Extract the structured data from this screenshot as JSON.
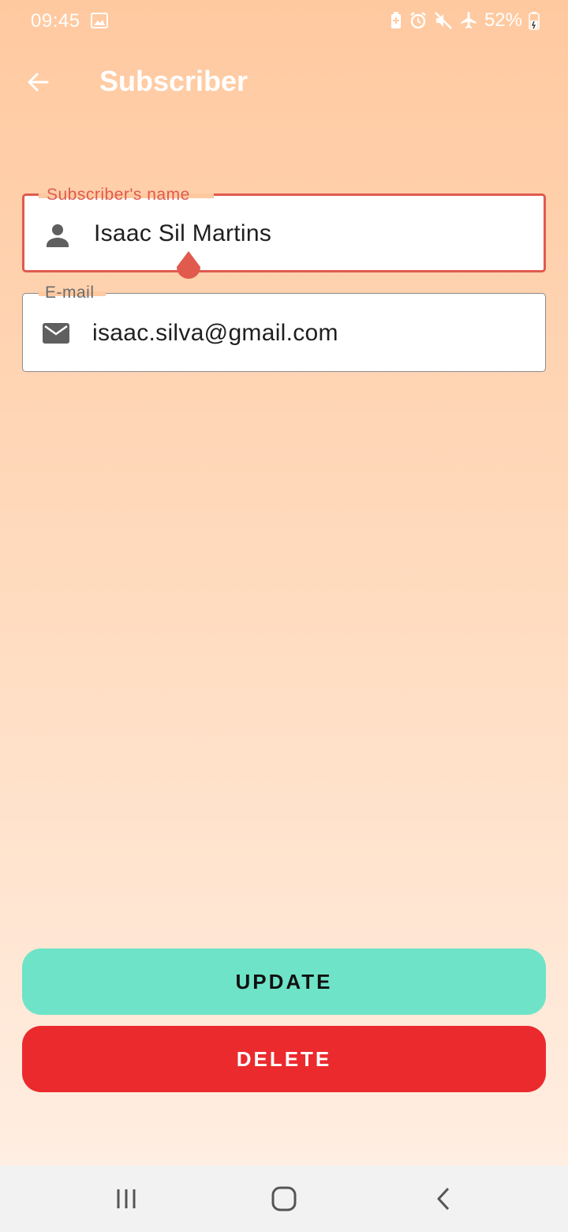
{
  "status_bar": {
    "time": "09:45",
    "battery": "52%",
    "icons": [
      "gallery-icon",
      "battery-saver-icon",
      "alarm-icon",
      "mute-icon",
      "airplane-icon",
      "battery-icon"
    ]
  },
  "app_bar": {
    "title": "Subscriber",
    "back_icon": "arrow-left-icon"
  },
  "form": {
    "name_field": {
      "label": "Subscriber's name",
      "value": "Isaac Sil Martins",
      "icon": "person-icon",
      "focused": true
    },
    "email_field": {
      "label": "E-mail",
      "value": "isaac.silva@gmail.com",
      "icon": "mail-icon"
    }
  },
  "actions": {
    "update_label": "UPDATE",
    "delete_label": "DELETE"
  },
  "nav_bar": {
    "items": [
      "recent-apps-icon",
      "home-icon",
      "back-icon"
    ]
  },
  "colors": {
    "background_top": "#ffc9a0",
    "background_bottom": "#fff0e6",
    "focus_accent": "#e05a4e",
    "update_button": "#6ee3c7",
    "delete_button": "#eb2a2e",
    "nav_bar": "#f2f2f2"
  }
}
